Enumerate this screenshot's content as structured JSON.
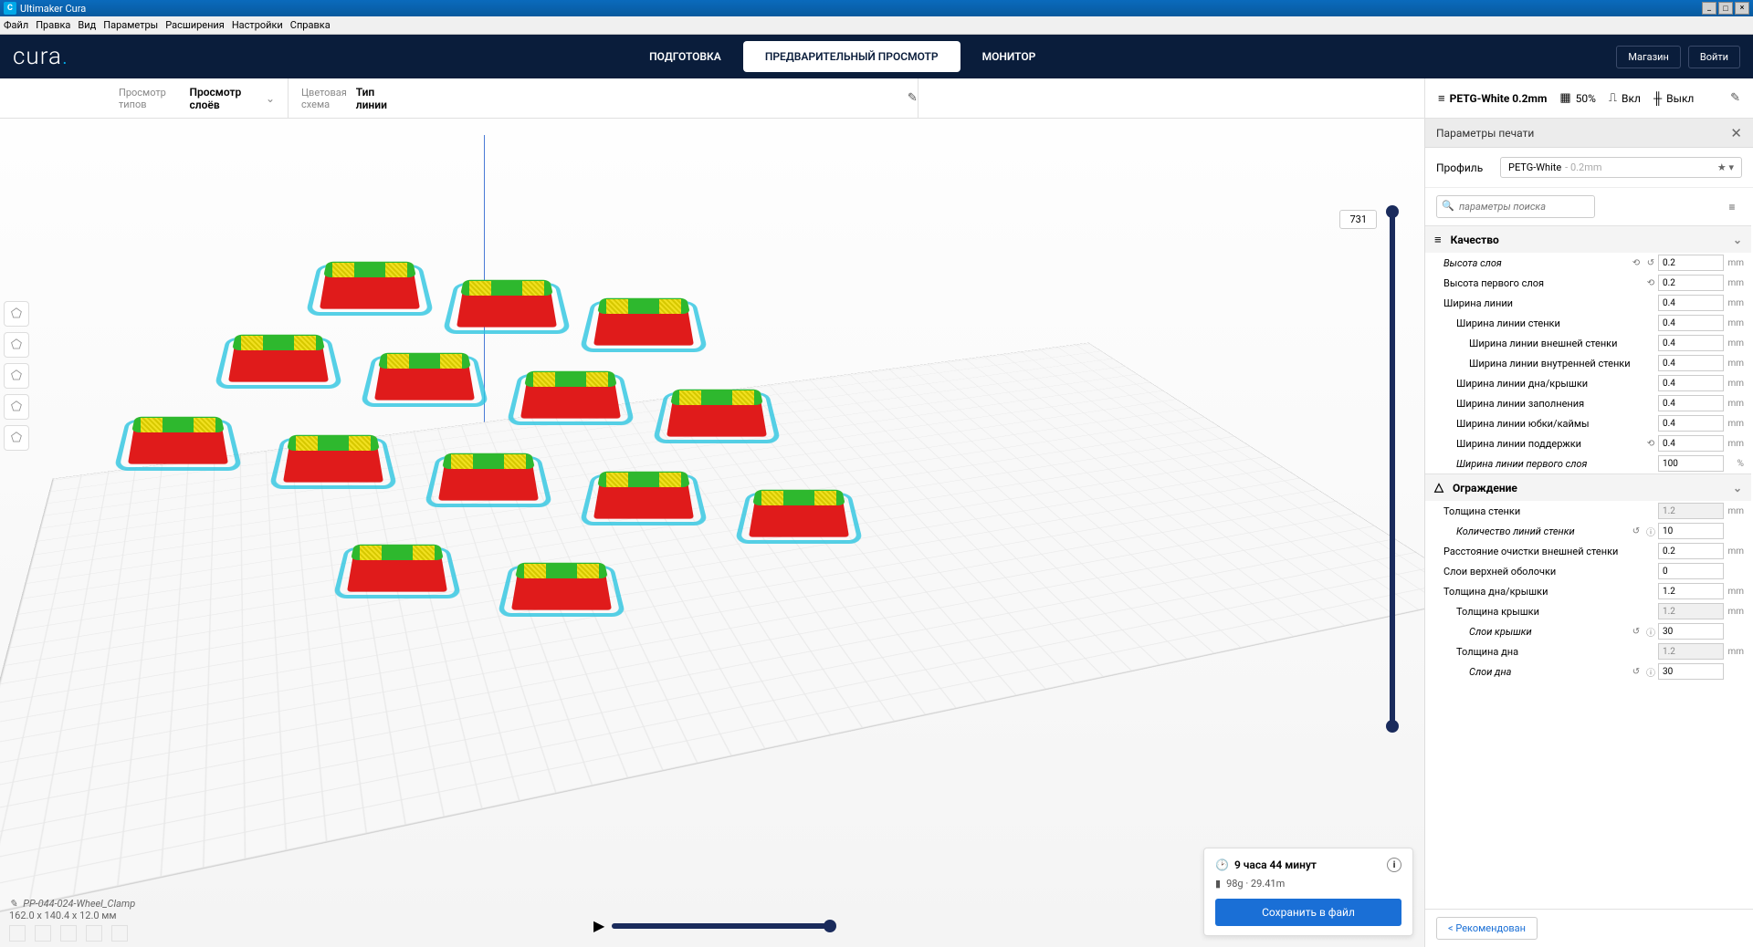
{
  "window": {
    "title": "Ultimaker Cura"
  },
  "menubar": [
    "Файл",
    "Правка",
    "Вид",
    "Параметры",
    "Расширения",
    "Настройки",
    "Справка"
  ],
  "logo": {
    "text": "cura",
    "dot": "."
  },
  "stages": {
    "prepare": "ПОДГОТОВКА",
    "preview": "ПРЕДВАРИТЕЛЬНЫЙ ПРОСМОТР",
    "monitor": "МОНИТОР"
  },
  "topright": {
    "market": "Магазин",
    "login": "Войти"
  },
  "secondbar": {
    "viewtypes_label": "Просмотр типов",
    "viewtypes_value": "Просмотр слоёв",
    "colorscheme_label": "Цветовая схема",
    "colorscheme_value": "Тип линии",
    "profile": "PETG-White 0.2mm",
    "infill": "50%",
    "support": "Вкл",
    "adhesion": "Выкл"
  },
  "panel": {
    "title": "Параметры печати",
    "profile_label": "Профиль",
    "profile_name": "PETG-White",
    "profile_suffix": " - 0.2mm",
    "search_placeholder": "параметры поиска",
    "cat_quality": "Качество",
    "cat_shell": "Ограждение",
    "recommended": "Рекомендован",
    "rows": {
      "layer_height": "Высота слоя",
      "initial_layer_height": "Высота первого слоя",
      "line_width": "Ширина линии",
      "wall_line_width": "Ширина линии стенки",
      "outer_wall_line_width": "Ширина линии внешней стенки",
      "inner_wall_line_width": "Ширина линии внутренней стенки",
      "topbot_line_width": "Ширина линии дна/крышки",
      "infill_line_width": "Ширина линии заполнения",
      "skirt_line_width": "Ширина линии юбки/каймы",
      "support_line_width": "Ширина линии поддержки",
      "initial_line_width": "Ширина линии первого слоя",
      "wall_thickness": "Толщина стенки",
      "wall_line_count": "Количество линий стенки",
      "outer_wall_wipe": "Расстояние очистки внешней стенки",
      "top_layers_shell": "Слои верхней оболочки",
      "topbot_thickness": "Толщина дна/крышки",
      "top_thickness": "Толщина крышки",
      "top_layers": "Слои крышки",
      "bottom_thickness": "Толщина дна",
      "bottom_layers": "Слои дна"
    },
    "vals": {
      "layer_height": "0.2",
      "initial_layer_height": "0.2",
      "line_width": "0.4",
      "wall_line_width": "0.4",
      "outer_wall_line_width": "0.4",
      "inner_wall_line_width": "0.4",
      "topbot_line_width": "0.4",
      "infill_line_width": "0.4",
      "skirt_line_width": "0.4",
      "support_line_width": "0.4",
      "initial_line_width": "100",
      "wall_thickness": "1.2",
      "wall_line_count": "10",
      "outer_wall_wipe": "0.2",
      "top_layers_shell": "0",
      "topbot_thickness": "1.2",
      "top_thickness": "1.2",
      "top_layers": "30",
      "bottom_thickness": "1.2",
      "bottom_layers": "30"
    },
    "units": {
      "mm": "mm",
      "pct": "%",
      "none": ""
    }
  },
  "layerslider": {
    "value": "731"
  },
  "fileinfo": {
    "name": "PP-044-024-Wheel_Clamp",
    "dims": "162.0 x 140.4 x 12.0 мм"
  },
  "savecard": {
    "time": "9 часа 44 минут",
    "material": "98g · 29.41m",
    "button": "Сохранить в файл"
  }
}
